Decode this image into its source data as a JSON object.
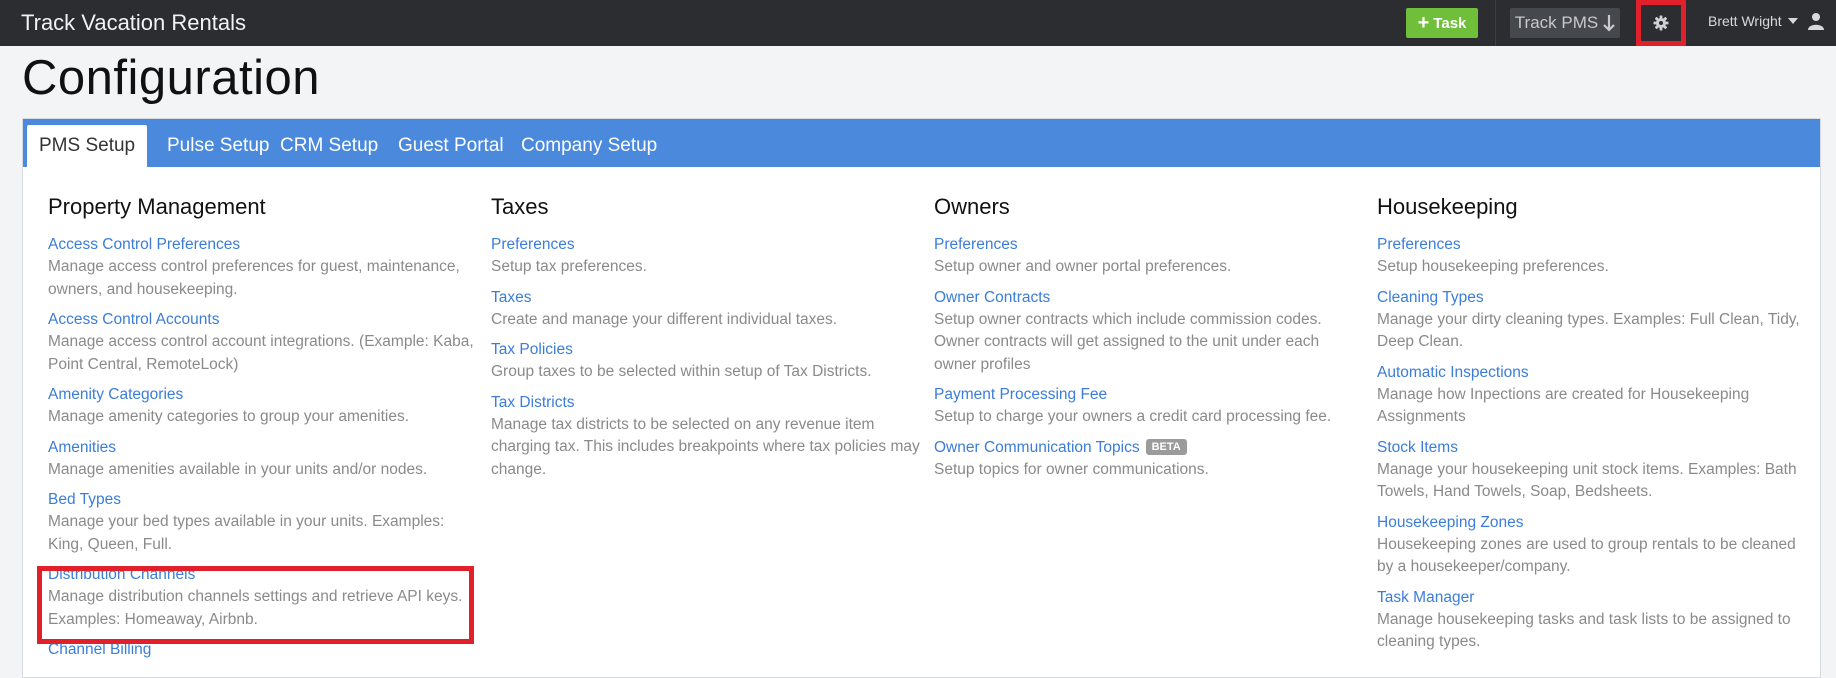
{
  "header": {
    "brand": "Track Vacation Rentals",
    "task_label": "Task",
    "pms_label": "Track PMS",
    "user_name": "Brett Wright"
  },
  "page": {
    "title": "Configuration"
  },
  "tabs": [
    {
      "label": "PMS Setup",
      "active": true
    },
    {
      "label": "Pulse Setup",
      "active": false
    },
    {
      "label": "CRM Setup",
      "active": false
    },
    {
      "label": "Guest Portal",
      "active": false
    },
    {
      "label": "Company Setup",
      "active": false
    }
  ],
  "columns": {
    "property": {
      "title": "Property Management",
      "items": [
        {
          "link": "Access Control Preferences",
          "desc": "Manage access control preferences for guest, maintenance, owners, and housekeeping."
        },
        {
          "link": "Access Control Accounts",
          "desc": "Manage access control account integrations. (Example: Kaba, Point Central, RemoteLock)"
        },
        {
          "link": "Amenity Categories",
          "desc": "Manage amenity categories to group your amenities."
        },
        {
          "link": "Amenities",
          "desc": "Manage amenities available in your units and/or nodes."
        },
        {
          "link": "Bed Types",
          "desc": "Manage your bed types available in your units. Examples: King, Queen, Full."
        },
        {
          "link": "Distribution Channels",
          "desc": "Manage distribution channels settings and retrieve API keys. Examples: Homeaway, Airbnb."
        },
        {
          "link": "Channel Billing",
          "desc": ""
        }
      ]
    },
    "taxes": {
      "title": "Taxes",
      "items": [
        {
          "link": "Preferences",
          "desc": "Setup tax preferences."
        },
        {
          "link": "Taxes",
          "desc": "Create and manage your different individual taxes."
        },
        {
          "link": "Tax Policies",
          "desc": "Group taxes to be selected within setup of Tax Districts."
        },
        {
          "link": "Tax Districts",
          "desc": "Manage tax districts to be selected on any revenue item charging tax. This includes breakpoints where tax policies may change."
        }
      ]
    },
    "owners": {
      "title": "Owners",
      "items": [
        {
          "link": "Preferences",
          "desc": "Setup owner and owner portal preferences."
        },
        {
          "link": "Owner Contracts",
          "desc": "Setup owner contracts which include commission codes. Owner contracts will get assigned to the unit under each owner profiles"
        },
        {
          "link": "Payment Processing Fee",
          "desc": "Setup to charge your owners a credit card processing fee."
        },
        {
          "link": "Owner Communication Topics",
          "desc": "Setup topics for owner communications.",
          "badge": "BETA"
        }
      ]
    },
    "housekeeping": {
      "title": "Housekeeping",
      "items": [
        {
          "link": "Preferences",
          "desc": "Setup housekeeping preferences."
        },
        {
          "link": "Cleaning Types",
          "desc": "Manage your dirty cleaning types. Examples: Full Clean, Tidy, Deep Clean."
        },
        {
          "link": "Automatic Inspections",
          "desc": "Manage how Inpections are created for Housekeeping Assignments"
        },
        {
          "link": "Stock Items",
          "desc": "Manage your housekeeping unit stock items. Examples: Bath Towels, Hand Towels, Soap, Bedsheets."
        },
        {
          "link": "Housekeeping Zones",
          "desc": "Housekeeping zones are used to group rentals to be cleaned by a housekeeper/company."
        },
        {
          "link": "Task Manager",
          "desc": "Manage housekeeping tasks and task lists to be assigned to cleaning types."
        }
      ]
    }
  }
}
